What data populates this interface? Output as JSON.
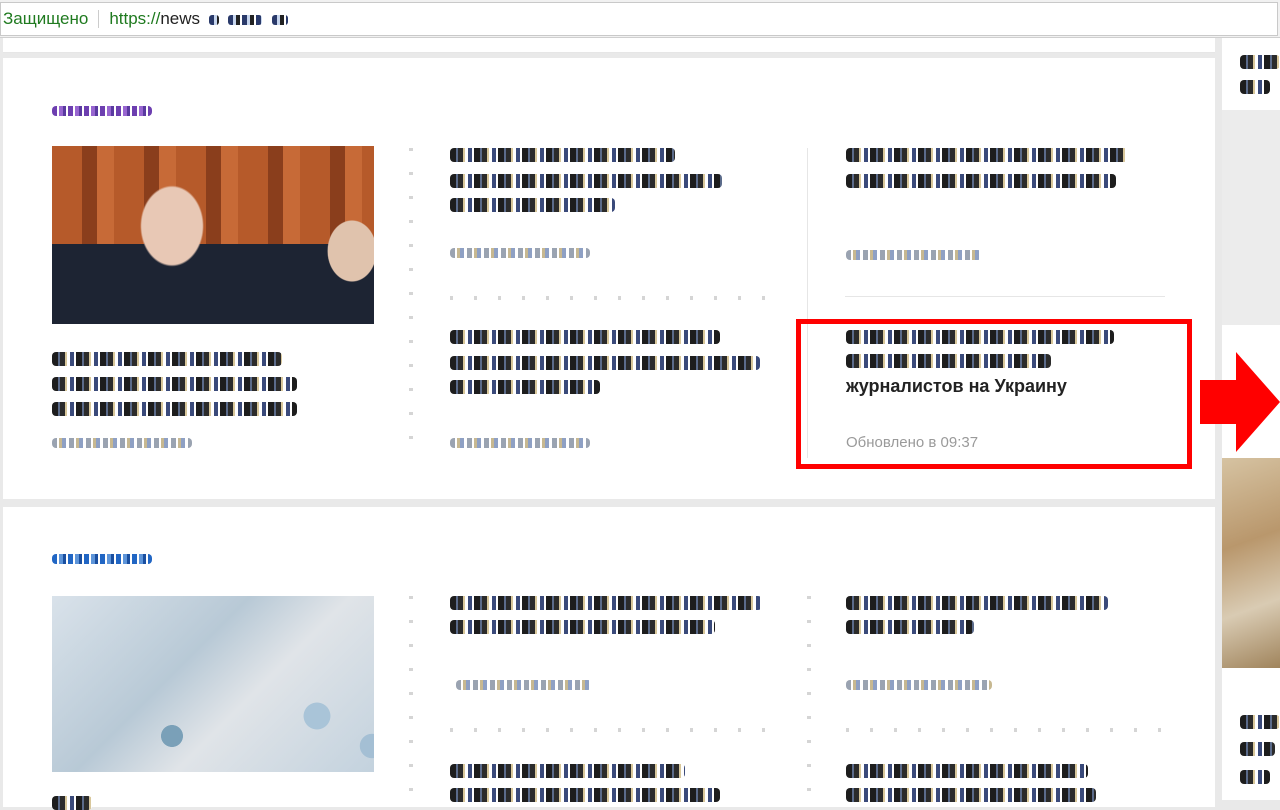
{
  "address_bar": {
    "secure_label": "Защищено",
    "url_scheme": "https://",
    "url_host": "news"
  },
  "highlighted_story": {
    "title_line": "журналистов на Украину",
    "updated": "Обновлено в 09:37"
  },
  "colors": {
    "highlight_border": "#ff0000",
    "arrow": "#ff0000",
    "secure_text": "#1f7a1f"
  },
  "icons": {
    "arrow": "right-arrow-icon"
  }
}
